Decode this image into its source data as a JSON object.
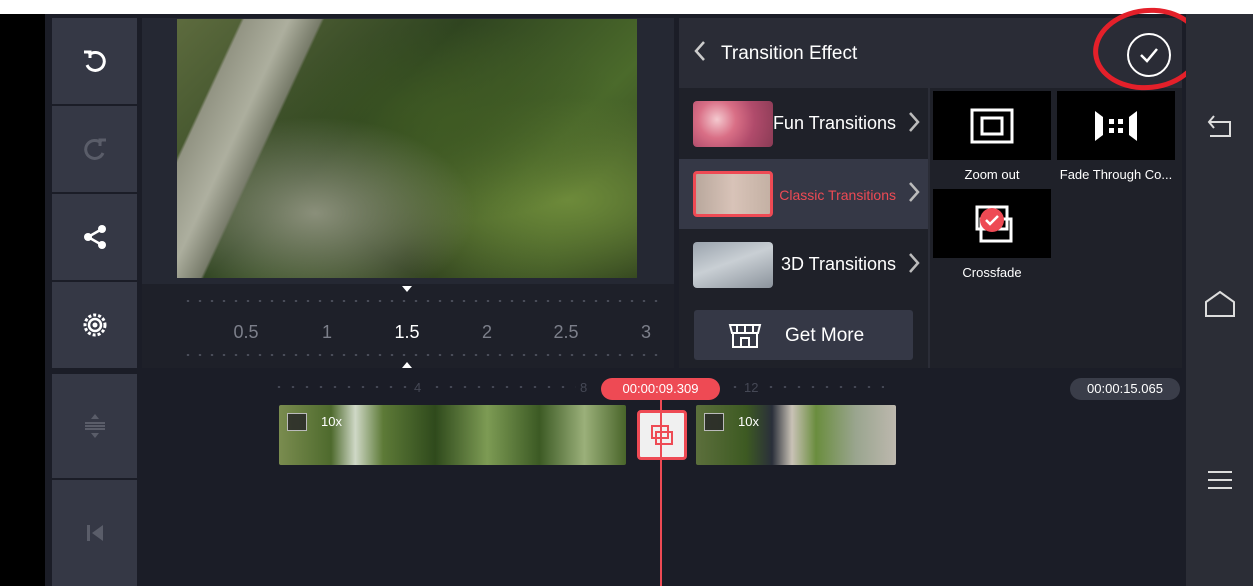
{
  "preview": {
    "speed_scale": [
      "0.5",
      "1",
      "1.5",
      "2",
      "2.5",
      "3"
    ],
    "selected_speed": "1.5"
  },
  "transition_panel": {
    "title": "Transition Effect",
    "categories": [
      {
        "label": "Fun Transitions"
      },
      {
        "label": "Classic Transitions"
      },
      {
        "label": "3D Transitions"
      }
    ],
    "get_more_label": "Get More",
    "effects": [
      {
        "name": "Zoom out",
        "icon": "zoom-out-icon"
      },
      {
        "name": "Fade Through Co...",
        "icon": "fade-through-color-icon"
      },
      {
        "name": "Crossfade",
        "icon": "crossfade-icon"
      }
    ]
  },
  "timeline": {
    "ticks": [
      "4",
      "8",
      "12"
    ],
    "playhead_time": "00:00:09.309",
    "end_time": "00:00:15.065",
    "clips": [
      {
        "speed": "10x"
      },
      {
        "speed": "10x"
      }
    ]
  },
  "colors": {
    "accent": "#ee4a54",
    "background": "#1b1d27",
    "panel": "#353845",
    "annotation": "#e4202a"
  }
}
